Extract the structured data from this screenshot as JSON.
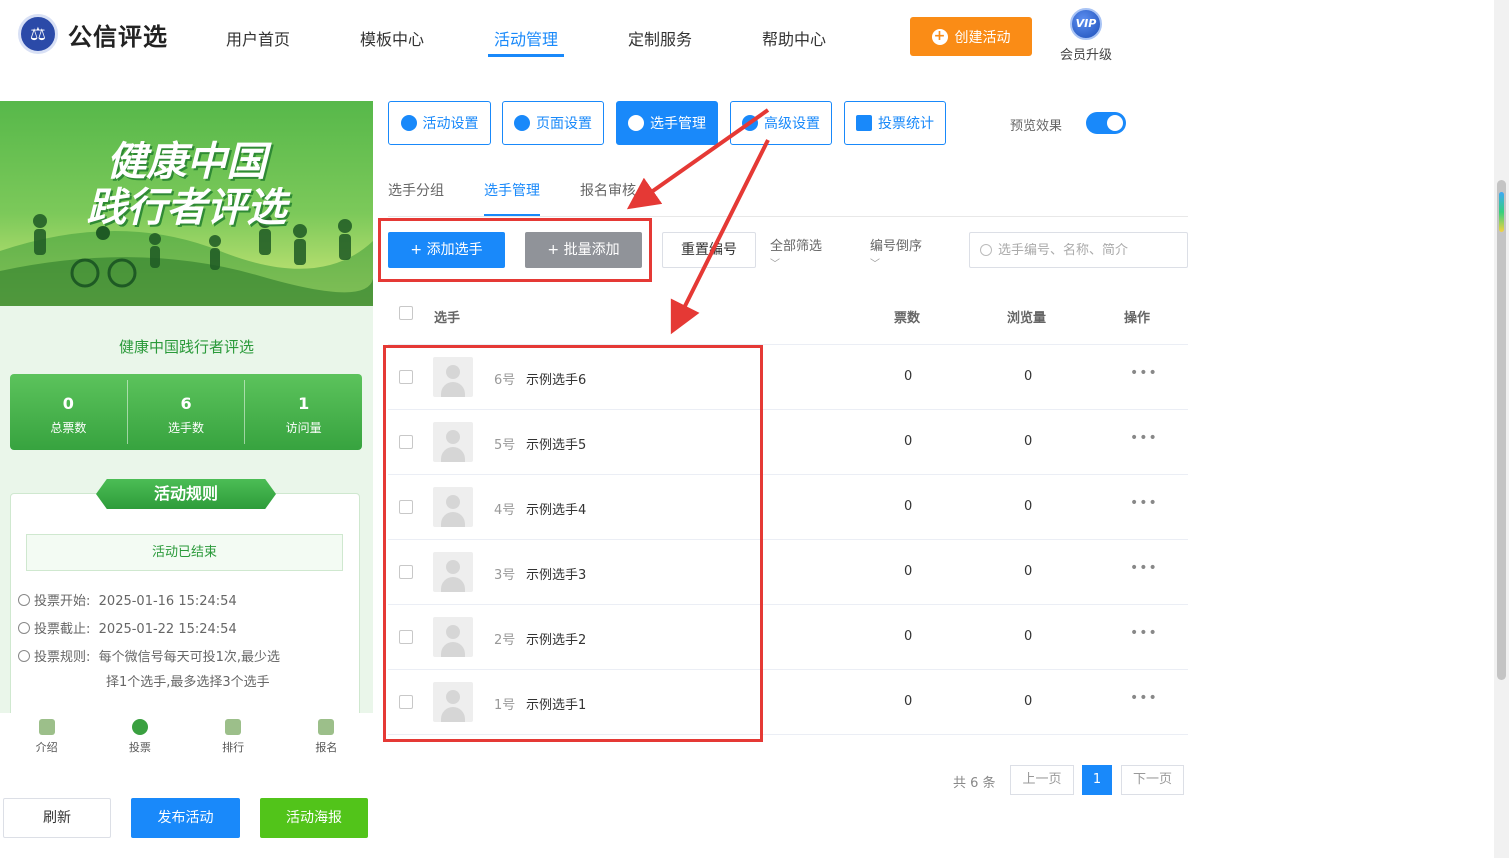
{
  "header": {
    "logo_text": "公信评选",
    "nav": [
      "用户首页",
      "模板中心",
      "活动管理",
      "定制服务",
      "帮助中心"
    ],
    "active_nav": "活动管理",
    "create_button": "创建活动",
    "vip_badge": "VIP",
    "vip_label": "会员升级"
  },
  "preview": {
    "banner_line1": "健康中国",
    "banner_line2": "践行者评选",
    "activity_name": "健康中国践行者评选",
    "stats": [
      {
        "value": "0",
        "label": "总票数"
      },
      {
        "value": "6",
        "label": "选手数"
      },
      {
        "value": "1",
        "label": "访问量"
      }
    ],
    "rules_title": "活动规则",
    "status_text": "活动已结束",
    "vote_start_label": "投票开始:",
    "vote_start": "2025-01-16 15:24:54",
    "vote_end_label": "投票截止:",
    "vote_end": "2025-01-22 15:24:54",
    "vote_rule_label": "投票规则:",
    "vote_rule_line1": "每个微信号每天可投1次,最少选",
    "vote_rule_line2": "择1个选手,最多选择3个选手",
    "bottom_nav": [
      "介绍",
      "投票",
      "排行",
      "报名"
    ]
  },
  "actions": {
    "refresh": "刷新",
    "publish": "发布活动",
    "poster": "活动海报"
  },
  "tabs": [
    "活动设置",
    "页面设置",
    "选手管理",
    "高级设置",
    "投票统计"
  ],
  "active_tab": "选手管理",
  "preview_toggle": {
    "label": "预览效果",
    "on": true
  },
  "subtabs": [
    "选手分组",
    "选手管理",
    "报名审核"
  ],
  "active_subtab": "选手管理",
  "toolbar": {
    "add": "添加选手",
    "batch_add": "批量添加",
    "reset_number": "重置编号",
    "filter_all": "全部筛选",
    "sort_desc": "编号倒序",
    "search_placeholder": "选手编号、名称、简介"
  },
  "table": {
    "columns": [
      "选手",
      "票数",
      "浏览量",
      "操作"
    ],
    "rows": [
      {
        "no": "6号",
        "name": "示例选手6",
        "votes": "0",
        "views": "0"
      },
      {
        "no": "5号",
        "name": "示例选手5",
        "votes": "0",
        "views": "0"
      },
      {
        "no": "4号",
        "name": "示例选手4",
        "votes": "0",
        "views": "0"
      },
      {
        "no": "3号",
        "name": "示例选手3",
        "votes": "0",
        "views": "0"
      },
      {
        "no": "2号",
        "name": "示例选手2",
        "votes": "0",
        "views": "0"
      },
      {
        "no": "1号",
        "name": "示例选手1",
        "votes": "0",
        "views": "0"
      }
    ],
    "more_icon": "•••"
  },
  "pagination": {
    "total": "共 6 条",
    "prev": "上一页",
    "current": "1",
    "next": "下一页"
  },
  "colors": {
    "primary": "#1989fa",
    "orange": "#fa8c16",
    "green": "#52c41a",
    "annotation_red": "#e53935"
  }
}
